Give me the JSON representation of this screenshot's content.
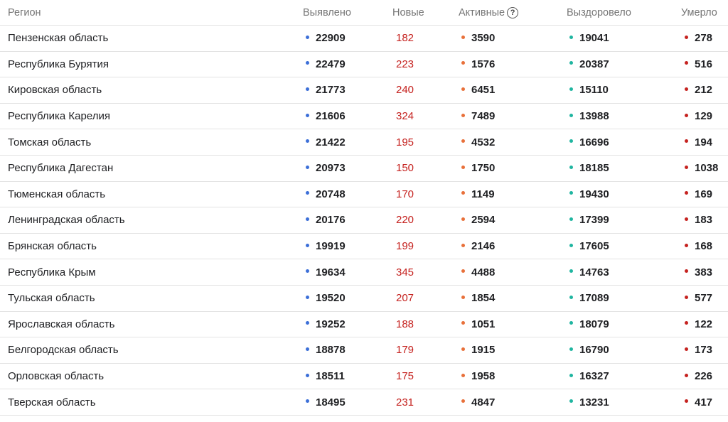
{
  "colors": {
    "detected": "#3c6fd8",
    "new": "#c5221f",
    "active": "#e8703a",
    "recovered": "#1fb5a0",
    "died": "#c5221f"
  },
  "header": {
    "region": "Регион",
    "detected": "Выявлено",
    "new": "Новые",
    "active": "Активные",
    "recovered": "Выздоровело",
    "died": "Умерло",
    "help_icon": "question-circle-icon"
  },
  "rows": [
    {
      "region": "Пензенская область",
      "detected": "22909",
      "new": "182",
      "active": "3590",
      "recovered": "19041",
      "died": "278"
    },
    {
      "region": "Республика Бурятия",
      "detected": "22479",
      "new": "223",
      "active": "1576",
      "recovered": "20387",
      "died": "516"
    },
    {
      "region": "Кировская область",
      "detected": "21773",
      "new": "240",
      "active": "6451",
      "recovered": "15110",
      "died": "212"
    },
    {
      "region": "Республика Карелия",
      "detected": "21606",
      "new": "324",
      "active": "7489",
      "recovered": "13988",
      "died": "129"
    },
    {
      "region": "Томская область",
      "detected": "21422",
      "new": "195",
      "active": "4532",
      "recovered": "16696",
      "died": "194"
    },
    {
      "region": "Республика Дагестан",
      "detected": "20973",
      "new": "150",
      "active": "1750",
      "recovered": "18185",
      "died": "1038"
    },
    {
      "region": "Тюменская область",
      "detected": "20748",
      "new": "170",
      "active": "1149",
      "recovered": "19430",
      "died": "169"
    },
    {
      "region": "Ленинградская область",
      "detected": "20176",
      "new": "220",
      "active": "2594",
      "recovered": "17399",
      "died": "183"
    },
    {
      "region": "Брянская область",
      "detected": "19919",
      "new": "199",
      "active": "2146",
      "recovered": "17605",
      "died": "168"
    },
    {
      "region": "Республика Крым",
      "detected": "19634",
      "new": "345",
      "active": "4488",
      "recovered": "14763",
      "died": "383"
    },
    {
      "region": "Тульская область",
      "detected": "19520",
      "new": "207",
      "active": "1854",
      "recovered": "17089",
      "died": "577"
    },
    {
      "region": "Ярославская область",
      "detected": "19252",
      "new": "188",
      "active": "1051",
      "recovered": "18079",
      "died": "122"
    },
    {
      "region": "Белгородская область",
      "detected": "18878",
      "new": "179",
      "active": "1915",
      "recovered": "16790",
      "died": "173"
    },
    {
      "region": "Орловская область",
      "detected": "18511",
      "new": "175",
      "active": "1958",
      "recovered": "16327",
      "died": "226"
    },
    {
      "region": "Тверская область",
      "detected": "18495",
      "new": "231",
      "active": "4847",
      "recovered": "13231",
      "died": "417"
    }
  ]
}
